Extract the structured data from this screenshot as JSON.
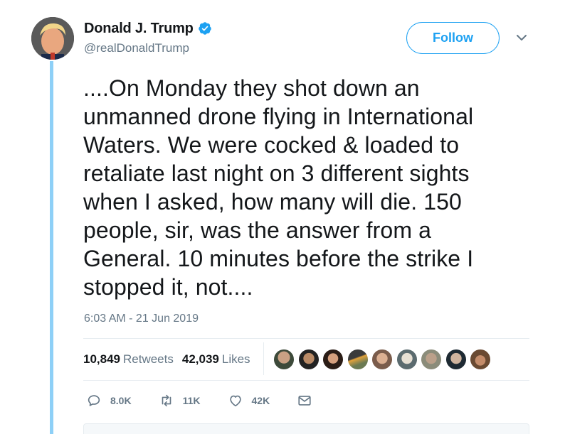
{
  "author": {
    "name": "Donald J. Trump",
    "handle": "@realDonaldTrump",
    "verified": true
  },
  "follow_label": "Follow",
  "tweet": {
    "text": "....On Monday they shot down an\nunmanned drone flying in International\nWaters. We were cocked & loaded to\nretaliate last night on 3 different sights\nwhen I asked, how many will die. 150\npeople, sir, was the answer from a\nGeneral. 10 minutes before the strike I\nstopped it, not....",
    "timestamp": "6:03 AM - 21 Jun 2019"
  },
  "stats": {
    "retweets_count": "10,849",
    "retweets_label": "Retweets",
    "likes_count": "42,039",
    "likes_label": "Likes"
  },
  "actions": {
    "reply_count": "8.0K",
    "retweet_count": "11K",
    "like_count": "42K"
  },
  "icons": [
    "verified-badge-icon",
    "chevron-down-icon",
    "reply-icon",
    "retweet-icon",
    "heart-icon",
    "envelope-icon"
  ],
  "colors": {
    "accent": "#1da1f2",
    "thread_line": "#8ed0f7",
    "muted_text": "#657786",
    "primary_text": "#14171a"
  }
}
